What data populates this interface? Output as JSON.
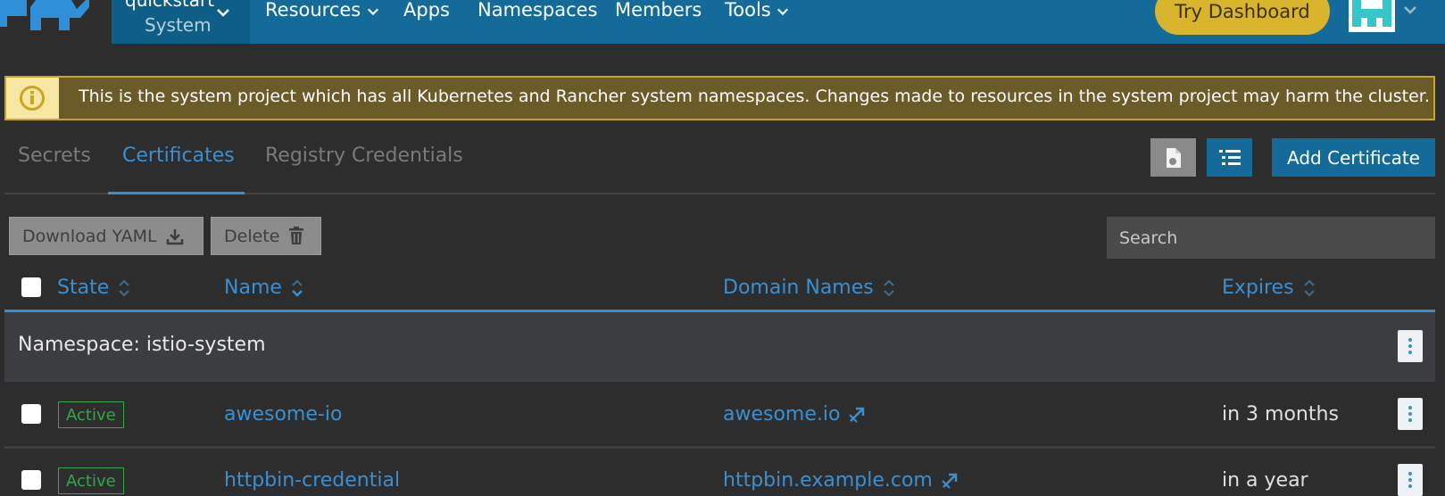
{
  "nav": {
    "project_name": "quickstart",
    "project_sub": "System",
    "items": [
      "Resources",
      "Apps",
      "Namespaces",
      "Members",
      "Tools"
    ],
    "try_dashboard": "Try Dashboard"
  },
  "banner": {
    "icon": "info-icon",
    "text": "This is the system project which has all Kubernetes and Rancher system namespaces. Changes made to resources in the system project may harm the cluster."
  },
  "tabs": [
    "Secrets",
    "Certificates",
    "Registry Credentials"
  ],
  "active_tab": "Certificates",
  "toolbar": {
    "add_certificate": "Add Certificate",
    "download_yaml": "Download YAML",
    "delete": "Delete",
    "search_placeholder": "Search"
  },
  "table": {
    "headers": {
      "state": "State",
      "name": "Name",
      "domain_names": "Domain Names",
      "expires": "Expires"
    },
    "group_label": "Namespace: istio-system",
    "rows": [
      {
        "state": "Active",
        "name": "awesome-io",
        "domain": "awesome.io",
        "expires": "in 3 months"
      },
      {
        "state": "Active",
        "name": "httpbin-credential",
        "domain": "httpbin.example.com",
        "expires": "in a year"
      }
    ]
  },
  "colors": {
    "nav_bg": "#146b9a",
    "accent": "#3b8fd1",
    "warning_border": "#c9a522",
    "warning_bg": "#6b5b29",
    "active_badge": "#39a34a",
    "try_button": "#d8b52c"
  }
}
